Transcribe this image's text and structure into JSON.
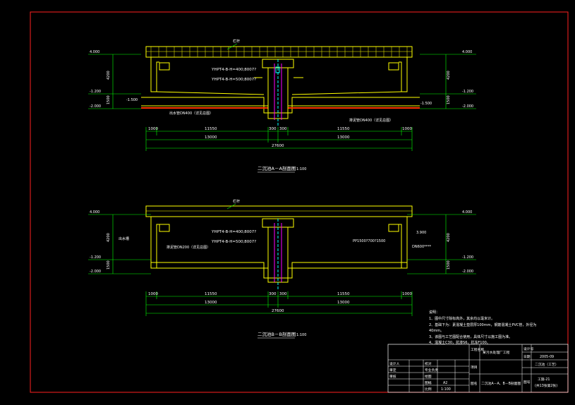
{
  "colors": {
    "background": "#000000",
    "frame": "#ff2020",
    "outline": "#ffffff",
    "structure": "#ffff00",
    "dimension": "#00ff00",
    "annotation": "#00ffff",
    "pipe": "#ff00ff",
    "hatch": "#ff3300"
  },
  "section_aa": {
    "title": "二沉池A－A剖面图",
    "scale": "1:100",
    "left_elevations": [
      "4.000",
      "-1.200",
      "-2.000"
    ],
    "right_elevations": [
      "4.000",
      "-1.200",
      "-2.000"
    ],
    "heights": [
      "4200",
      "1500"
    ],
    "outlet_elevation": "-1.500",
    "dims_row1": [
      "1000",
      "11550",
      "300",
      "300",
      "11550",
      "1000"
    ],
    "dims_row2": [
      "13000",
      "13000"
    ],
    "dims_total": "27600",
    "callouts": [
      "YHPT4-B-H=400;8007?",
      "YHPT4-B-H=500;8007?",
      "出水管DN400（详见总图）",
      "排泥管DN400（详见总图）",
      "栏杆"
    ]
  },
  "section_bb": {
    "title": "二沉池B－B剖面图",
    "scale": "1:100",
    "left_elevations": [
      "4.000",
      "-1.200",
      "-2.000"
    ],
    "right_elevations": [
      "4.000",
      "-1.200",
      "-2.000"
    ],
    "heights": [
      "4200",
      "1500"
    ],
    "side_elevation": "3.900",
    "dims_row1": [
      "1000",
      "11550",
      "300",
      "300",
      "11550",
      "1000"
    ],
    "dims_row2": [
      "13000",
      "13000"
    ],
    "dims_total": "27600",
    "callouts": [
      "YHPT4-B-H=400;8007?",
      "YHPT4-B-H=500;8007?",
      "排泥管DN200（详见总图）",
      "PP1500?700?1500",
      "DN600****",
      "出水槽",
      "栏杆"
    ]
  },
  "notes": {
    "heading": "说明：",
    "lines": [
      "1、图中尺寸除标高外，其余均以毫米计。",
      "2、基础下为：素混凝土垫层厚100mm，钢筋混凝土PVC管，外径为",
      "   40mm。",
      "3、该图与工艺图配合使用，具体尺寸以施工图为准。",
      "4、混凝土C30，抗渗S6，抗冻F100。"
    ]
  },
  "title_block": {
    "project_label": "工程名称",
    "project": "某污水处理厂工程",
    "design_no_label": "设计号",
    "date_label": "日期",
    "date": "2005-09",
    "item_label": "项目",
    "item": "二沉池（工艺）",
    "drawing_label": "图名",
    "drawing": "二沉池A－A、B－B剖面图",
    "sheet_label": "图号",
    "sheet_no": "工施-21",
    "sheet_sub": "(共13张第2张)",
    "rows_left": [
      "设计人",
      "审定",
      "审核"
    ],
    "rows_mid": [
      "校对",
      "专业负责",
      "绘图"
    ],
    "size_label": "图幅",
    "size": "A2",
    "scale_label": "比例",
    "scale": "1:100"
  }
}
